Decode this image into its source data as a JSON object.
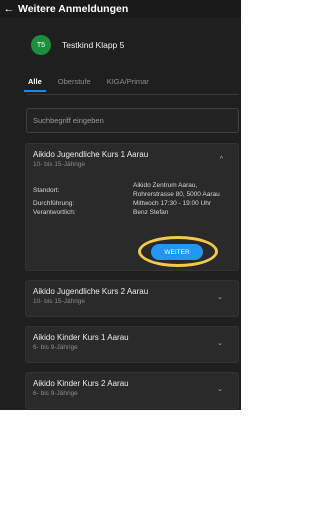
{
  "header": {
    "back_icon": "←",
    "title": "Weitere Anmeldungen"
  },
  "user": {
    "initials": "T5",
    "name": "Testkind Klapp 5",
    "avatar_color": "#1b8f3d"
  },
  "tabs": [
    {
      "label": "Alle",
      "active": true
    },
    {
      "label": "Oberstufe",
      "active": false
    },
    {
      "label": "KIGA/Primar",
      "active": false
    }
  ],
  "search": {
    "placeholder": "Suchbegriff eingeben"
  },
  "courses": [
    {
      "title": "Aikido Jugendliche Kurs 1 Aarau",
      "age": "10- bis 15-Jährige",
      "expanded": true,
      "chevron": "^",
      "details": {
        "standort_label": "Standort:",
        "standort_line1": "Aikido Zentrum Aarau,",
        "standort_line2": "Rohrerstrasse 80, 5000 Aarau",
        "durchfuehrung_label": "Durchführung:",
        "durchfuehrung_value": "Mittwoch 17:30 - 19:00 Uhr",
        "verantwortlich_label": "Verantwortlich:",
        "verantwortlich_value": "Benz Stefan"
      },
      "button_label": "WEITER"
    },
    {
      "title": "Aikido Jugendliche Kurs 2 Aarau",
      "age": "10- bis 15-Jährige",
      "expanded": false,
      "chevron": "⌄"
    },
    {
      "title": "Aikido Kinder Kurs 1 Aarau",
      "age": "6- bis 9-Jährige",
      "expanded": false,
      "chevron": "⌄"
    },
    {
      "title": "Aikido Kinder Kurs 2 Aarau",
      "age": "6- bis 9-Jährige",
      "expanded": false,
      "chevron": "⌄"
    }
  ],
  "colors": {
    "accent": "#2196f3",
    "highlight": "#f2c94c",
    "background": "#1f1f1f"
  }
}
